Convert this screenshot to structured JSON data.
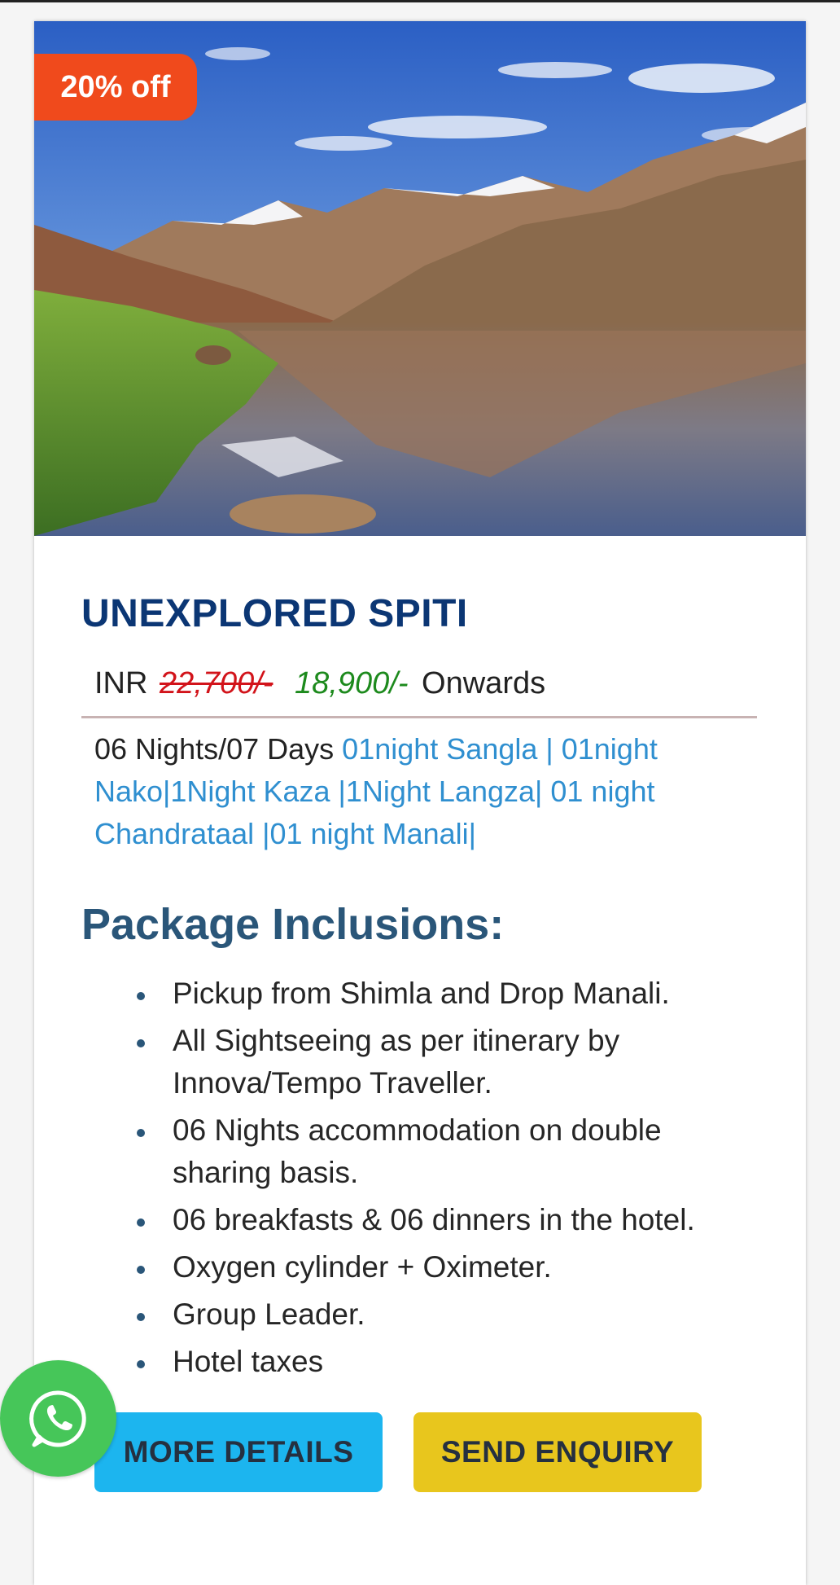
{
  "badge": {
    "discount": "20% off"
  },
  "package": {
    "title": "UNEXPLORED SPITI",
    "currency": "INR",
    "old_price": "22,700/-",
    "new_price": "18,900/-",
    "price_suffix": "Onwards",
    "duration": "06 Nights/07 Days",
    "route": "01night Sangla | 01night Nako|1Night Kaza |1Night Langza| 01 night Chandrataal |01 night Manali|"
  },
  "inclusions": {
    "heading": "Package Inclusions:",
    "items": [
      "Pickup from Shimla and Drop Manali.",
      "All Sightseeing as per itinerary by Innova/Tempo Traveller.",
      "06 Nights accommodation on double sharing basis.",
      "06 breakfasts & 06 dinners in the hotel.",
      "Oxygen cylinder + Oximeter.",
      "Group Leader.",
      "Hotel taxes"
    ]
  },
  "buttons": {
    "more_details": "MORE DETAILS",
    "send_enquiry": "SEND ENQUIRY"
  },
  "icons": {
    "whatsapp": "whatsapp-icon"
  },
  "colors": {
    "badge": "#f04a1c",
    "title": "#0b3674",
    "old_price": "#d2131a",
    "new_price": "#1d8a1d",
    "route": "#2f8fd0",
    "inclusions_heading": "#2a5679",
    "more_details_button": "#1cb5ef",
    "send_enquiry_button": "#e8c61d",
    "whatsapp": "#46c659"
  }
}
